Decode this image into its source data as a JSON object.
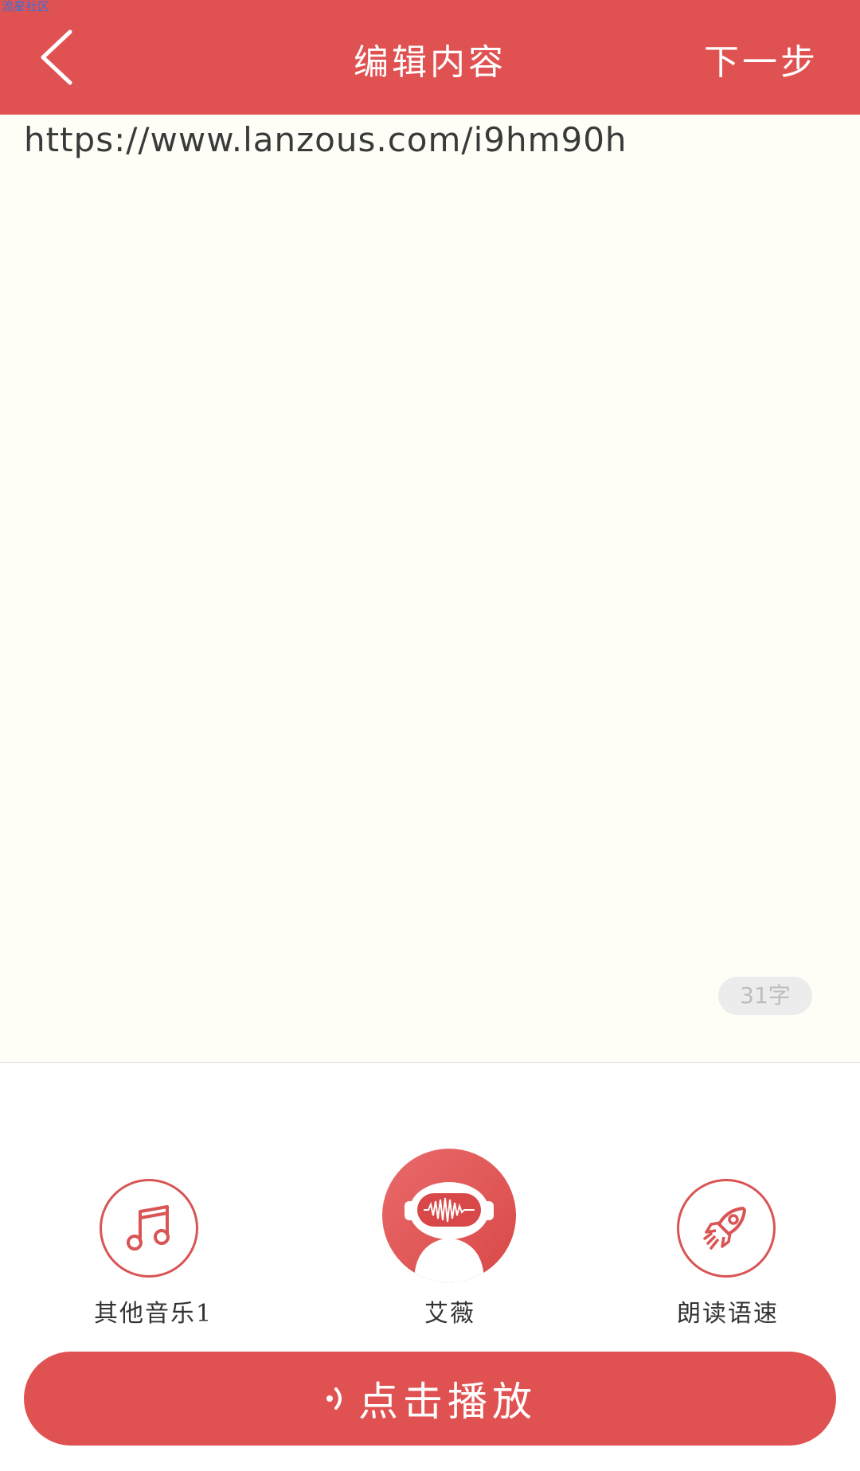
{
  "watermark": "流星社区",
  "header": {
    "title": "编辑内容",
    "next_label": "下一步"
  },
  "editor": {
    "content": "https://www.lanzous.com/i9hm90h",
    "char_count": "31字"
  },
  "options": [
    {
      "label": "其他音乐1",
      "icon": "music-note-icon"
    },
    {
      "label": "艾薇",
      "icon": "robot-voice-avatar-icon"
    },
    {
      "label": "朗读语速",
      "icon": "rocket-icon"
    }
  ],
  "play_button": {
    "label": "点击播放",
    "icon": "sound-icon"
  },
  "colors": {
    "accent": "#e05252",
    "editor_bg": "#fefdf6"
  }
}
